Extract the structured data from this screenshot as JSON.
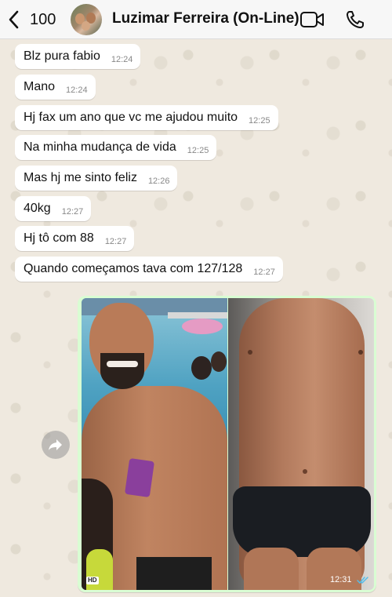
{
  "header": {
    "back_count": "100",
    "contact_name": "Luzimar Ferreira (On-Line)",
    "icons": [
      "chevron-left-icon",
      "video-call-icon",
      "phone-icon"
    ]
  },
  "messages": [
    {
      "text": "Blz pura fabio",
      "time": "12:24"
    },
    {
      "text": "Mano",
      "time": "12:24"
    },
    {
      "text": "Hj fax um ano que vc me ajudou muito",
      "time": "12:25"
    },
    {
      "text": "Na minha mudança de vida",
      "time": "12:25"
    },
    {
      "text": "Mas hj me sinto feliz",
      "time": "12:26"
    },
    {
      "text": "40kg",
      "time": "12:27"
    },
    {
      "text": "Hj tô com 88",
      "time": "12:27"
    },
    {
      "text": "Quando começamos tava com 127/128",
      "time": "12:27"
    }
  ],
  "image_message": {
    "hd_label": "HD",
    "time": "12:31",
    "status": "read"
  },
  "colors": {
    "chat_background": "#efe9df",
    "incoming_bubble": "#ffffff",
    "outgoing_bubble": "#d9fdd3",
    "read_ticks": "#53bdeb"
  }
}
